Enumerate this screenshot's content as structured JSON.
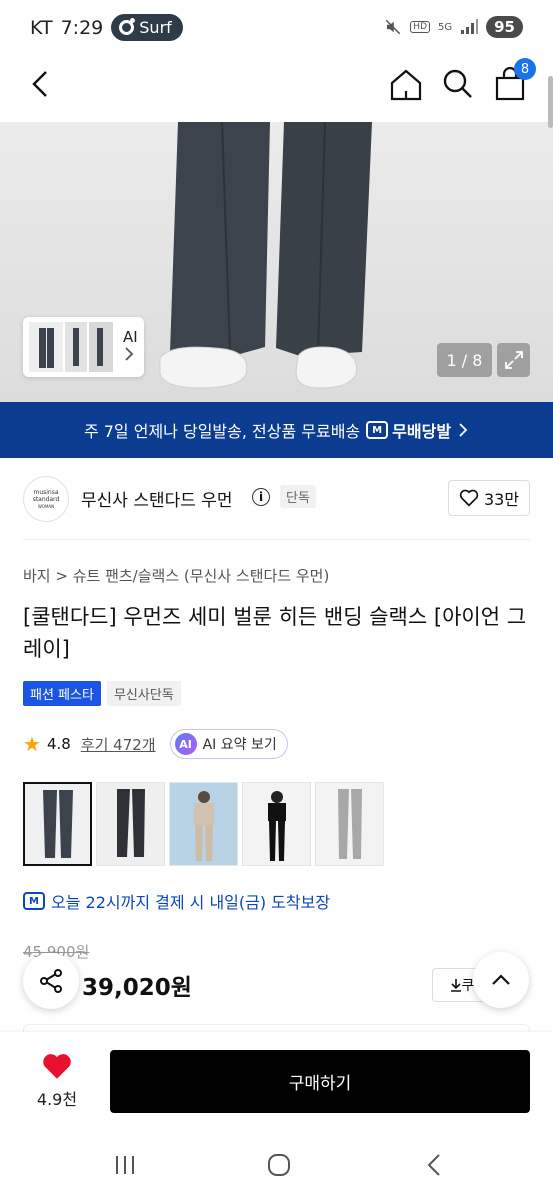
{
  "status_bar": {
    "carrier": "KT",
    "time": "7:29",
    "app_pill": "Surf",
    "hd": "HD",
    "network": "5G",
    "battery": "95"
  },
  "header": {
    "cart_count": "8"
  },
  "hero": {
    "thumb_label": "AI",
    "counter": "1 / 8"
  },
  "banner": {
    "text": "주 7일 언제나 당일발송, 전상품 무료배송",
    "brand_logo": "M",
    "brand": "무배당발"
  },
  "brand": {
    "logo_lines": [
      "musinsa",
      "standard",
      "WOMAN"
    ],
    "name": "무신사 스탠다드 우먼",
    "info_glyph": "i",
    "exclusive_tag": "단독",
    "likes": "33만"
  },
  "product": {
    "breadcrumb": "바지 > 슈트 팬츠/슬랙스 (무신사 스탠다드 우먼)",
    "title": "[쿨탠다드] 우먼즈 세미 벌룬 히든 밴딩 슬랙스 [아이언 그레이]",
    "tags": [
      "패션 페스타",
      "무신사단독"
    ],
    "rating": "4.8",
    "reviews": "후기 472개",
    "ai_badge": "AI",
    "ai_summary": "AI 요약 보기",
    "variants": [
      "아이언 그레이",
      "차콜",
      "베이지",
      "블랙",
      "그레이"
    ],
    "delivery_logo": "M",
    "delivery_note": "오늘 22시까지 결제 시 내일(금) 도착보장",
    "original_price": "45,900원",
    "price": "39,020원",
    "coupon": "쿠"
  },
  "bottom_bar": {
    "favorites": "4.9천",
    "buy": "구매하기"
  },
  "colors": {
    "banner": "#0b3c8f",
    "accent_blue": "#1a55e3",
    "heart": "#e8112d",
    "star": "#f6a700"
  }
}
